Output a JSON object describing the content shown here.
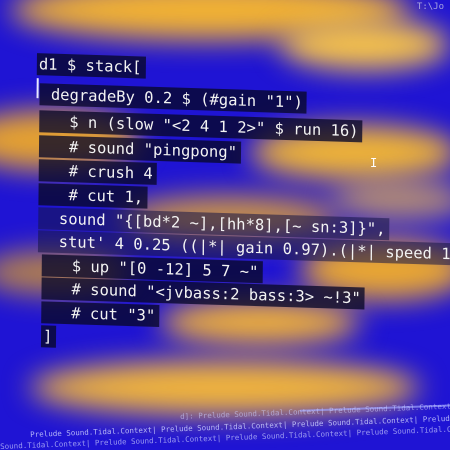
{
  "corner": {
    "text": "T:\\Jo"
  },
  "editor": {
    "lines": [
      "d1 $ stack[",
      " degradeBy 0.2 $ (#gain \"1\")",
      "   $ n (slow \"<2 4 1 2>\" $ run 16)",
      "   # sound \"pingpong\"",
      "   # crush 4",
      "   # cut 1,",
      "  sound \"{[bd*2 ~],[hh*8],[~ sn:3]}\",",
      "  stut' 4 0.25 ((|*| gain 0.97).(|*| speed 1",
      "   $ up \"[0 -12] 5 7 ~\"",
      "   # sound \"<jvbass:2 bass:3> ~!3\"",
      "   # cut \"3\"",
      "]"
    ]
  },
  "statusbar": {
    "row1": "d]: Prelude Sound.Tidal.Context| Prelude Sound.Tidal.Context|",
    "row2": "Prelude Sound.Tidal.Context| Prelude Sound.Tidal.Context| Prelude Sound.Tidal.Context| Prelude Sound.Tidal.Context| Prelude Sound.Tidal.Context| Prelude Sound.Tidal.Context|",
    "row3": "Sound.Tidal.Context| Prelude Sound.Tidal.Context| Prelude Sound.Tidal.Context| Prelude Sound.Tidal.Context| Prelude Sound.Tidal.Context|"
  }
}
